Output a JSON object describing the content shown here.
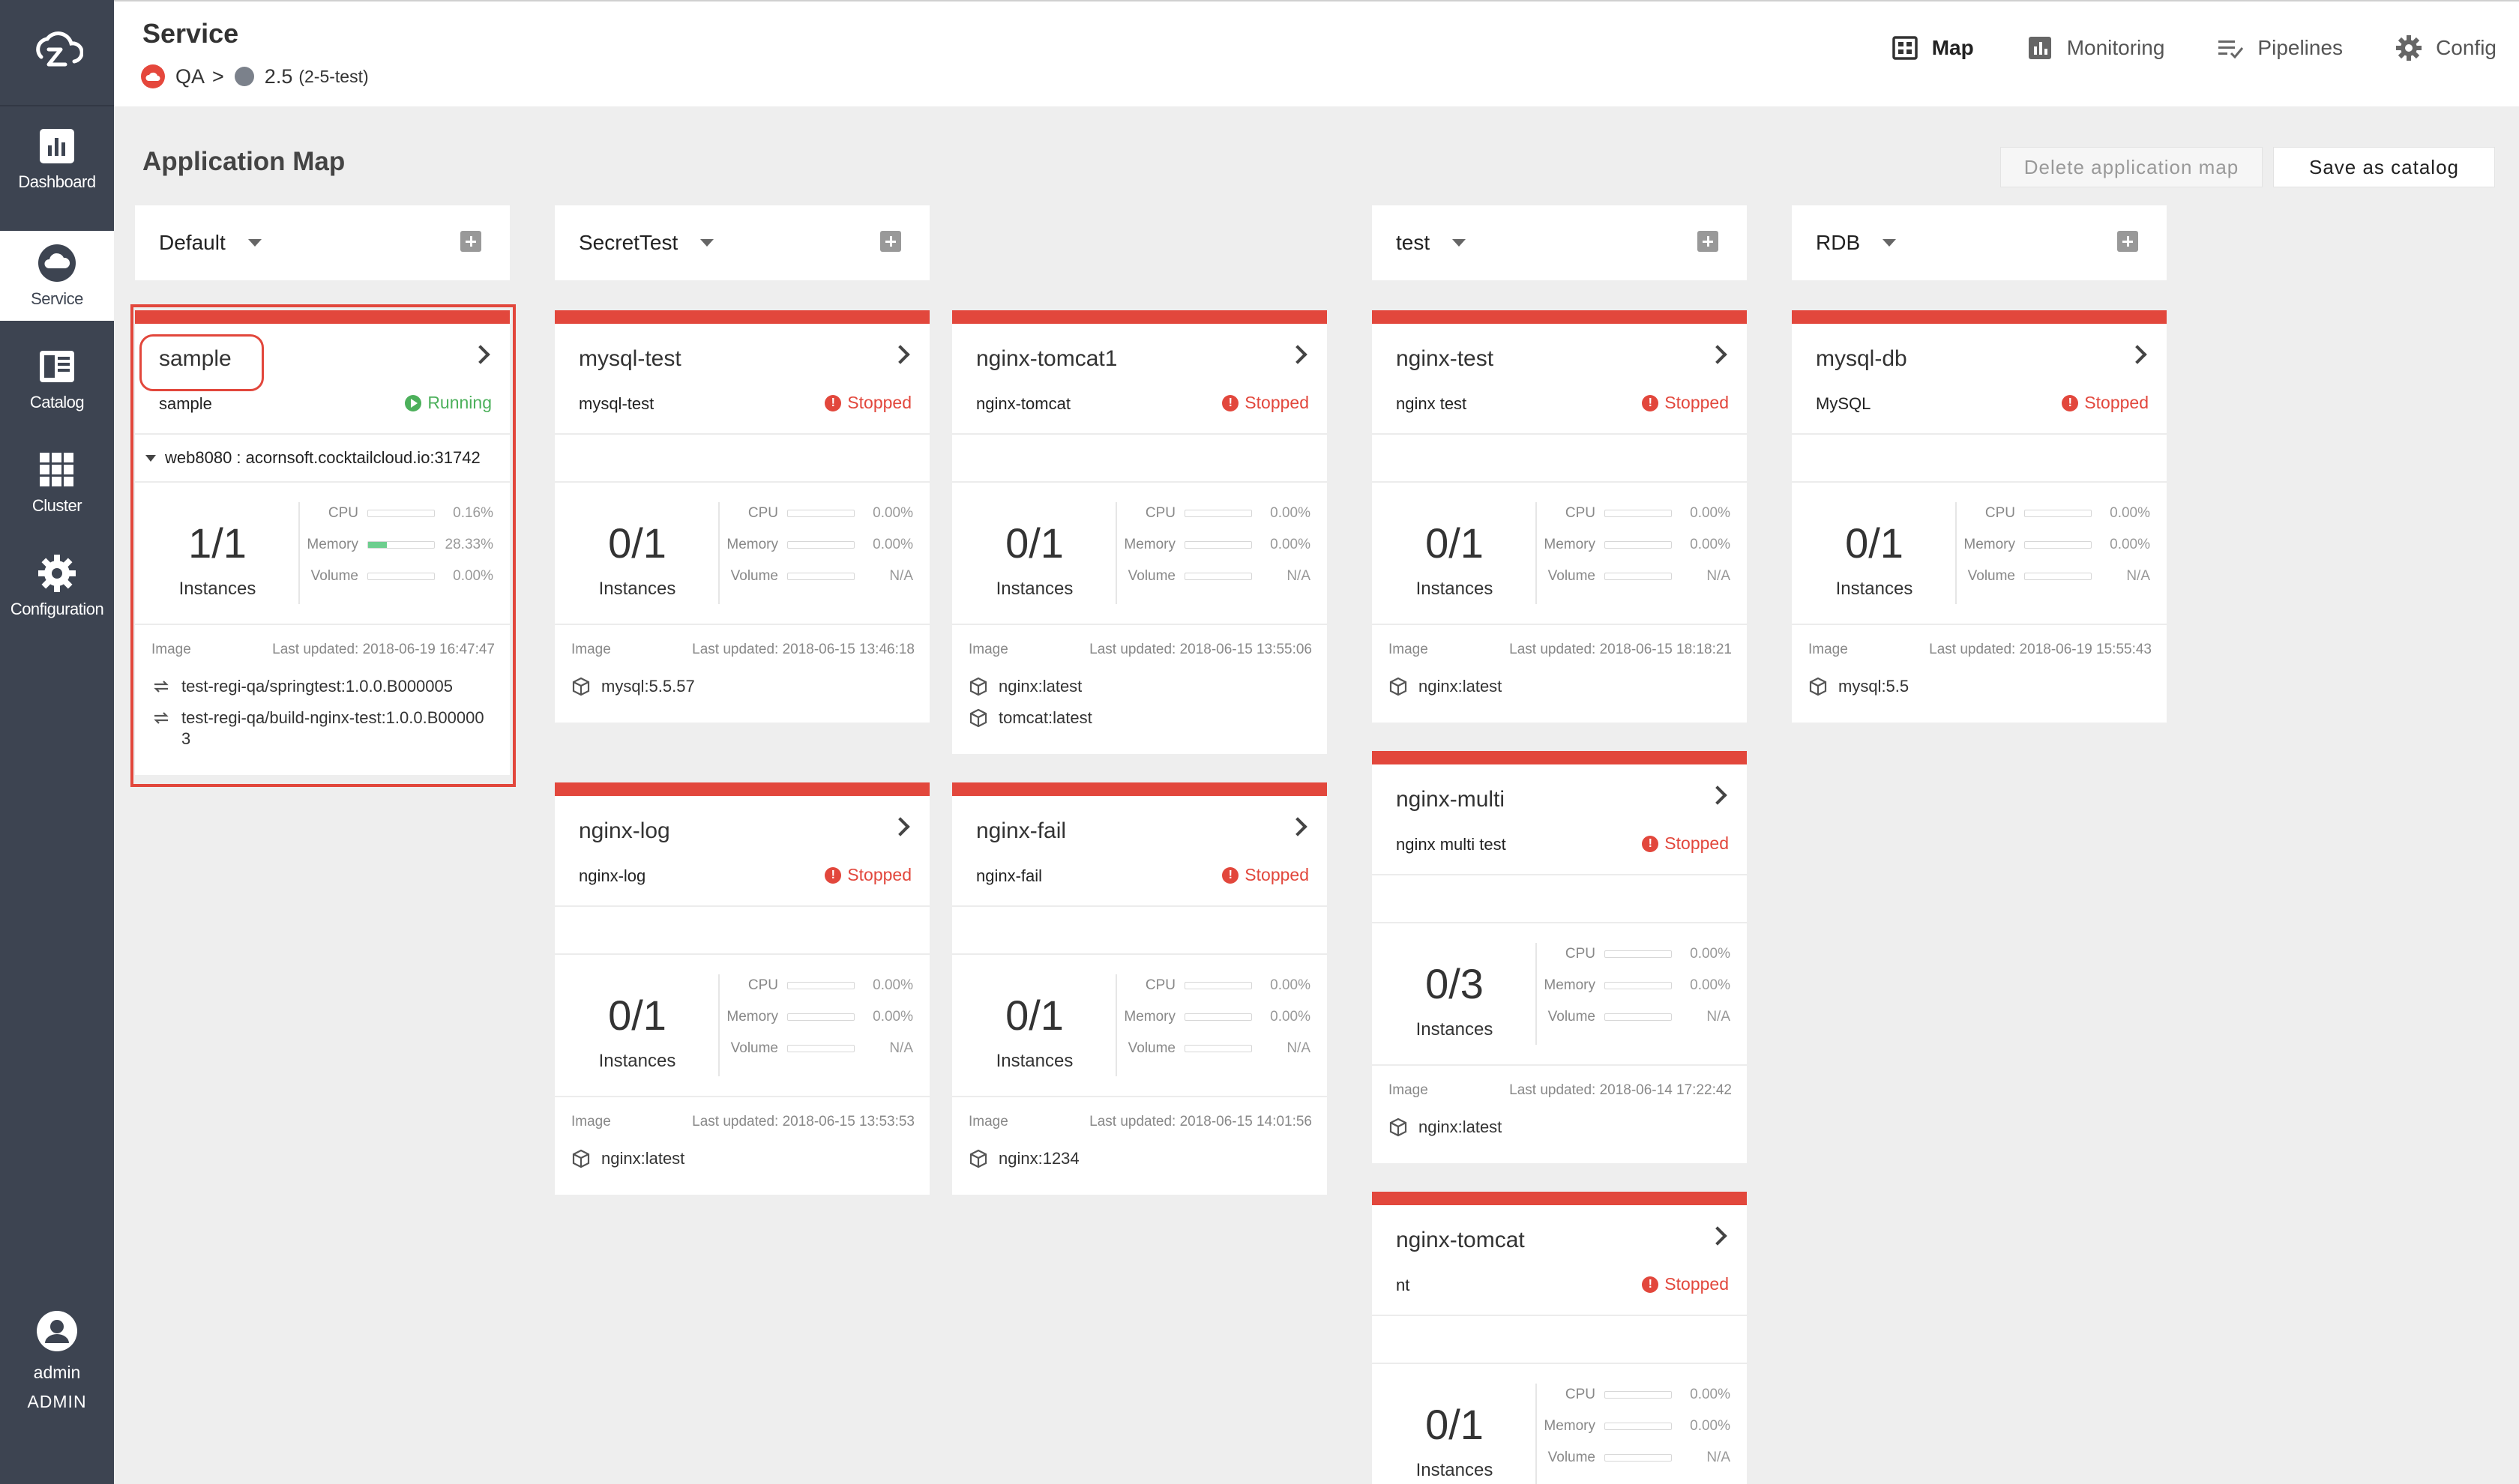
{
  "header": {
    "title": "Service",
    "breadcrumb": {
      "cluster": "QA",
      "sep": ">",
      "version": "2.5",
      "version_sub": "(2-5-test)"
    },
    "tabs": [
      {
        "label": "Map",
        "icon": "map-icon",
        "active": true
      },
      {
        "label": "Monitoring",
        "icon": "monitoring-icon",
        "active": false
      },
      {
        "label": "Pipelines",
        "icon": "pipelines-icon",
        "active": false
      },
      {
        "label": "Config",
        "icon": "gear-icon",
        "active": false
      }
    ]
  },
  "sidebar": {
    "items": [
      {
        "label": "Dashboard",
        "icon": "dashboard-icon",
        "active": false
      },
      {
        "label": "Service",
        "icon": "cloud-icon",
        "active": true
      },
      {
        "label": "Catalog",
        "icon": "catalog-icon",
        "active": false
      },
      {
        "label": "Cluster",
        "icon": "cluster-icon",
        "active": false
      },
      {
        "label": "Configuration",
        "icon": "gear-icon",
        "active": false
      }
    ],
    "user": {
      "name": "admin",
      "role": "ADMIN"
    }
  },
  "main": {
    "heading": "Application Map",
    "delete_label": "Delete application map",
    "save_label": "Save as catalog",
    "groups": [
      {
        "name": "Default"
      },
      {
        "name": "SecretTest"
      },
      {
        "name": "test"
      },
      {
        "name": "RDB"
      }
    ],
    "metric_labels": {
      "cpu": "CPU",
      "memory": "Memory",
      "volume": "Volume",
      "instances": "Instances",
      "image": "Image"
    },
    "cards": [
      {
        "name": "sample",
        "desc": "sample",
        "status": "Running",
        "endpoint": "web8080 : acornsoft.cocktailcloud.io:31742",
        "instances": "1/1",
        "cpu": "0.16%",
        "memory": "28.33%",
        "memory_fraction": 0.2833,
        "volume": "0.00%",
        "updated": "Last updated: 2018-06-19 16:47:47",
        "images": [
          "test-regi-qa/springtest:1.0.0.B000005",
          "test-regi-qa/build-nginx-test:1.0.0.B000003"
        ]
      },
      {
        "name": "mysql-test",
        "desc": "mysql-test",
        "status": "Stopped",
        "instances": "0/1",
        "cpu": "0.00%",
        "memory": "0.00%",
        "volume": "N/A",
        "updated": "Last updated: 2018-06-15 13:46:18",
        "images": [
          "mysql:5.5.57"
        ]
      },
      {
        "name": "nginx-tomcat1",
        "desc": "nginx-tomcat",
        "status": "Stopped",
        "instances": "0/1",
        "cpu": "0.00%",
        "memory": "0.00%",
        "volume": "N/A",
        "updated": "Last updated: 2018-06-15 13:55:06",
        "images": [
          "nginx:latest",
          "tomcat:latest"
        ]
      },
      {
        "name": "nginx-log",
        "desc": "nginx-log",
        "status": "Stopped",
        "instances": "0/1",
        "cpu": "0.00%",
        "memory": "0.00%",
        "volume": "N/A",
        "updated": "Last updated: 2018-06-15 13:53:53",
        "images": [
          "nginx:latest"
        ]
      },
      {
        "name": "nginx-fail",
        "desc": "nginx-fail",
        "status": "Stopped",
        "instances": "0/1",
        "cpu": "0.00%",
        "memory": "0.00%",
        "volume": "N/A",
        "updated": "Last updated: 2018-06-15 14:01:56",
        "images": [
          "nginx:1234"
        ]
      },
      {
        "name": "nginx-test",
        "desc": "nginx test",
        "status": "Stopped",
        "instances": "0/1",
        "cpu": "0.00%",
        "memory": "0.00%",
        "volume": "N/A",
        "updated": "Last updated: 2018-06-15 18:18:21",
        "images": [
          "nginx:latest"
        ]
      },
      {
        "name": "nginx-multi",
        "desc": "nginx multi test",
        "status": "Stopped",
        "instances": "0/3",
        "cpu": "0.00%",
        "memory": "0.00%",
        "volume": "N/A",
        "updated": "Last updated: 2018-06-14 17:22:42",
        "images": [
          "nginx:latest"
        ]
      },
      {
        "name": "nginx-tomcat",
        "desc": "nt",
        "status": "Stopped",
        "instances": "0/1",
        "cpu": "0.00%",
        "memory": "0.00%",
        "volume": "N/A",
        "updated": "",
        "images": []
      },
      {
        "name": "mysql-db",
        "desc": "MySQL",
        "status": "Stopped",
        "instances": "0/1",
        "cpu": "0.00%",
        "memory": "0.00%",
        "volume": "N/A",
        "updated": "Last updated: 2018-06-19 15:55:43",
        "images": [
          "mysql:5.5"
        ]
      }
    ]
  },
  "colors": {
    "sidebar": "#3d4451",
    "accent_red": "#e2473c",
    "running_green": "#4cb05b",
    "background": "#eeeeee"
  }
}
